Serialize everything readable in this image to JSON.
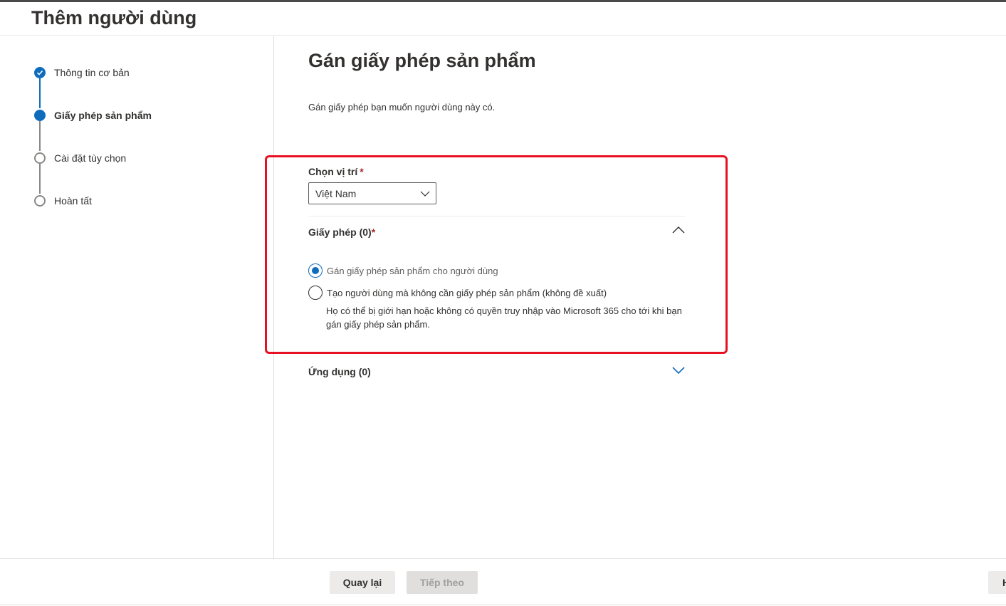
{
  "page": {
    "title": "Thêm người dùng"
  },
  "steps": [
    {
      "label": "Thông tin cơ bản",
      "state": "done"
    },
    {
      "label": "Giấy phép sản phẩm",
      "state": "current"
    },
    {
      "label": "Cài đặt tùy chọn",
      "state": "todo"
    },
    {
      "label": "Hoàn tất",
      "state": "todo"
    }
  ],
  "main": {
    "title": "Gán giấy phép sản phẩm",
    "description": "Gán giấy phép bạn muốn người dùng này có.",
    "location": {
      "label": "Chọn vị trí",
      "required_mark": "*",
      "value": "Việt Nam"
    },
    "licenses": {
      "header": "Giấy phép (0)",
      "required_mark": "*",
      "expanded": true,
      "options": [
        {
          "label": "Gán giấy phép sản phẩm cho người dùng",
          "selected": true
        },
        {
          "label": "Tạo người dùng mà không cần giấy phép sản phẩm (không đề xuất)",
          "selected": false
        }
      ],
      "help_text": "Họ có thể bị giới hạn hoặc không có quyền truy nhập vào Microsoft 365 cho tới khi bạn gán giấy phép sản phẩm."
    },
    "apps": {
      "header": "Ứng dụng (0)",
      "expanded": false
    }
  },
  "footer": {
    "back_label": "Quay lại",
    "next_label": "Tiếp theo",
    "right_label": "H"
  },
  "colors": {
    "accent": "#0f6cbd",
    "highlight": "#e81123",
    "required": "#a4262c"
  },
  "icons": {
    "step_done": "checkmark-icon",
    "dropdown": "chevron-down-icon",
    "collapse": "chevron-up-icon",
    "expand": "chevron-down-icon"
  }
}
